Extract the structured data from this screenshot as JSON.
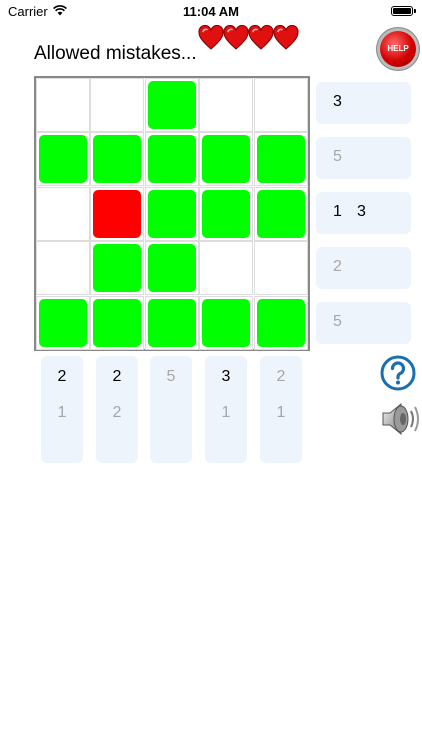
{
  "status_bar": {
    "carrier": "Carrier",
    "time": "11:04 AM"
  },
  "header": {
    "mistakes_label": "Allowed mistakes...",
    "lives": 4,
    "help_label": "HELP"
  },
  "colors": {
    "filled": "#00ff00",
    "mistake": "#ff0000",
    "clue_bg": "#eef4fb",
    "clue_done": "#a7a7a7",
    "heart": "#e01010"
  },
  "grid": {
    "rows": 5,
    "cols": 5,
    "cells": [
      [
        "empty",
        "empty",
        "filled",
        "empty",
        "empty"
      ],
      [
        "filled",
        "filled",
        "filled",
        "filled",
        "filled"
      ],
      [
        "empty",
        "mistake",
        "filled",
        "filled",
        "filled"
      ],
      [
        "empty",
        "filled",
        "filled",
        "empty",
        "empty"
      ],
      [
        "filled",
        "filled",
        "filled",
        "filled",
        "filled"
      ]
    ]
  },
  "row_clues": [
    {
      "numbers": [
        "3"
      ],
      "solved": false
    },
    {
      "numbers": [
        "5"
      ],
      "solved": true
    },
    {
      "numbers": [
        "1",
        "3"
      ],
      "solved": false
    },
    {
      "numbers": [
        "2"
      ],
      "solved": true
    },
    {
      "numbers": [
        "5"
      ],
      "solved": true
    }
  ],
  "col_clues": [
    {
      "numbers": [
        "2",
        "1"
      ],
      "states": [
        "todo",
        "done"
      ]
    },
    {
      "numbers": [
        "2",
        "2"
      ],
      "states": [
        "todo",
        "done"
      ]
    },
    {
      "numbers": [
        "5"
      ],
      "states": [
        "done"
      ]
    },
    {
      "numbers": [
        "3",
        "1"
      ],
      "states": [
        "todo",
        "done"
      ]
    },
    {
      "numbers": [
        "2",
        "1"
      ],
      "states": [
        "done",
        "done"
      ]
    }
  ],
  "icons": {
    "question": "question-icon",
    "speaker": "speaker-icon",
    "heart": "heart-icon",
    "wifi": "wifi-icon",
    "battery": "battery-icon"
  }
}
